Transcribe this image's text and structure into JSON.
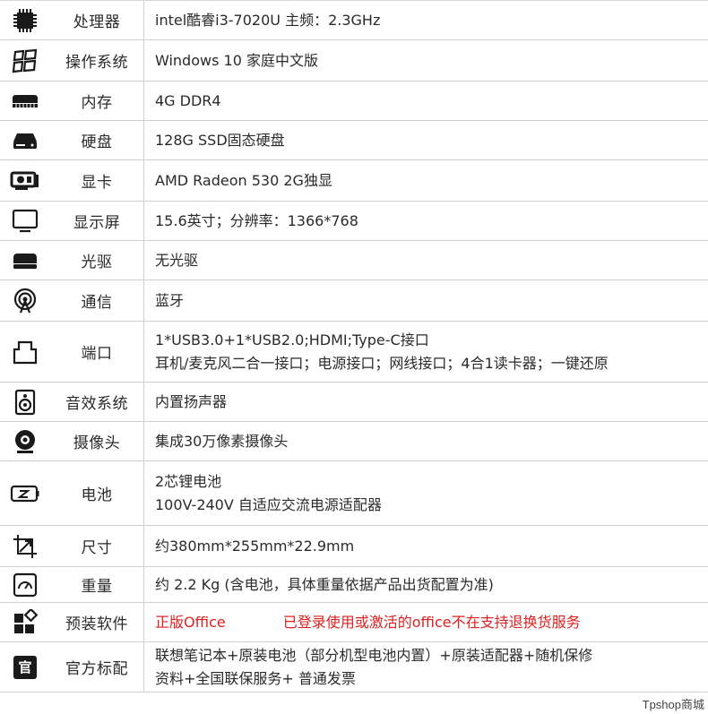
{
  "specs": [
    {
      "icon": "cpu-icon",
      "name": "处理器",
      "lines": [
        "intel酷睿i3-7020U 主频：2.3GHz"
      ]
    },
    {
      "icon": "windows-icon",
      "name": "操作系统",
      "lines": [
        "Windows 10 家庭中文版"
      ]
    },
    {
      "icon": "memory-icon",
      "name": "内存",
      "lines": [
        "4G  DDR4"
      ]
    },
    {
      "icon": "hard-disk-icon",
      "name": "硬盘",
      "lines": [
        "128G SSD固态硬盘"
      ]
    },
    {
      "icon": "graphics-card-icon",
      "name": "显卡",
      "lines": [
        "AMD Radeon 530 2G独显"
      ]
    },
    {
      "icon": "monitor-icon",
      "name": "显示屏",
      "lines": [
        "15.6英寸；分辨率：1366*768"
      ]
    },
    {
      "icon": "optical-drive-icon",
      "name": "光驱",
      "lines": [
        "无光驱"
      ]
    },
    {
      "icon": "bluetooth-signal-icon",
      "name": "通信",
      "lines": [
        "蓝牙"
      ]
    },
    {
      "icon": "port-icon",
      "name": "端口",
      "lines": [
        "1*USB3.0+1*USB2.0;HDMI;Type-C接口",
        "耳机/麦克风二合一接口；电源接口；网线接口；4合1读卡器；一键还原"
      ]
    },
    {
      "icon": "speaker-icon",
      "name": "音效系统",
      "lines": [
        "内置扬声器"
      ]
    },
    {
      "icon": "webcam-icon",
      "name": "摄像头",
      "lines": [
        "集成30万像素摄像头"
      ]
    },
    {
      "icon": "battery-icon",
      "name": "电池",
      "lines": [
        "2芯锂电池",
        "100V-240V 自适应交流电源适配器"
      ]
    },
    {
      "icon": "dimensions-icon",
      "name": "尺寸",
      "lines": [
        "约380mm*255mm*22.9mm"
      ]
    },
    {
      "icon": "weight-scale-icon",
      "name": "重量",
      "lines": [
        "约 2.2 Kg (含电池，具体重量依据产品出货配置为准)"
      ]
    },
    {
      "icon": "software-icon",
      "name": "预装软件",
      "red_parts": [
        "正版Office",
        "已登录使用或激活的office不在支持退换货服务"
      ]
    },
    {
      "icon": "official-seal-icon",
      "name": "官方标配",
      "icon_text": "官",
      "lines": [
        "联想笔记本+原装电池（部分机型电池内置）+原装适配器+随机保修",
        "资料+全国联保服务+ 普通发票"
      ]
    }
  ],
  "watermark": "Tpshop商城",
  "colors": {
    "text": "#2a2a2a",
    "warning": "#e02020",
    "border": "#cfcfcf"
  }
}
